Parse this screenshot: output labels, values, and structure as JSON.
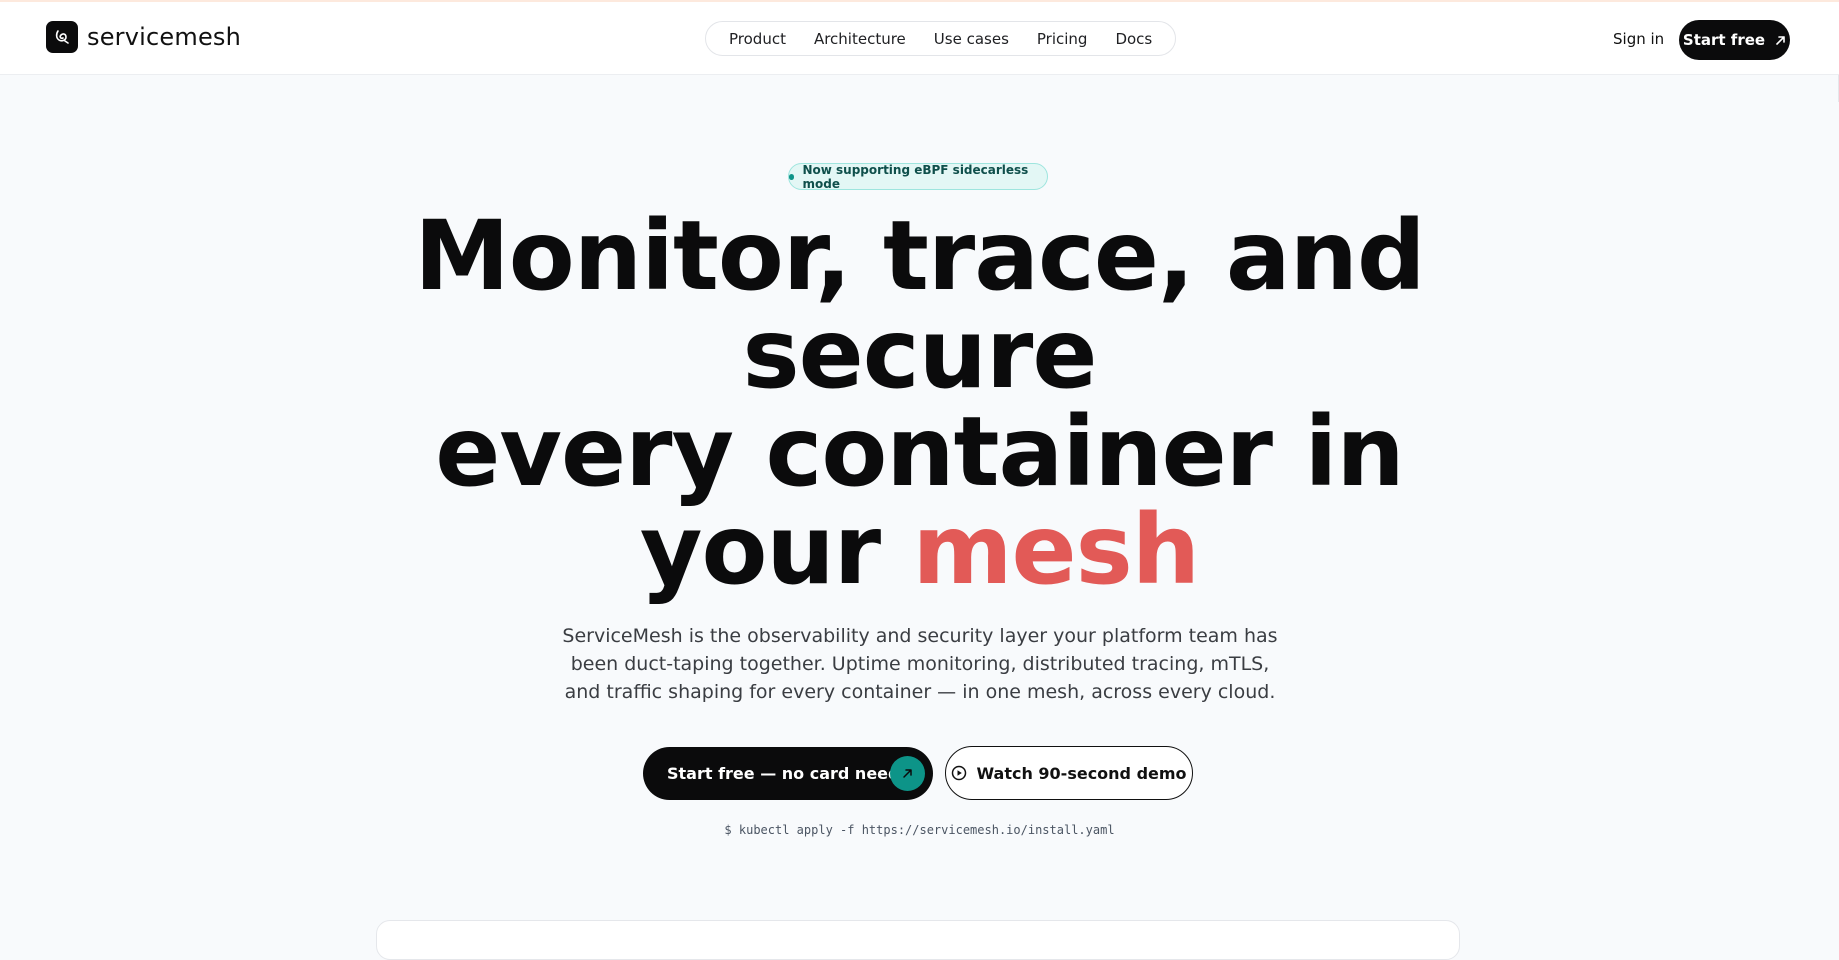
{
  "brand": {
    "name": "servicemesh",
    "logo_icon": "loop-mark-icon"
  },
  "nav": {
    "links": [
      "Product",
      "Architecture",
      "Use cases",
      "Pricing",
      "Docs"
    ],
    "sign_in": "Sign in",
    "start_free": "Start free",
    "start_free_icon": "arrow-up-right-icon"
  },
  "hero": {
    "badge": "Now supporting eBPF sidecarless mode",
    "headline_lines": [
      "Monitor, trace, and",
      "secure",
      "every container in"
    ],
    "headline_last_prefix": "your ",
    "headline_accent": "mesh",
    "subtitle": "ServiceMesh is the observability and security layer your platform team has been duct-taping together. Uptime monitoring, distributed tracing, mTLS, and traffic shaping for every container — in one mesh, across every cloud.",
    "cta_primary": "Start free — no card needed",
    "cta_secondary": "Watch 90-second demo",
    "install_command": "$ kubectl apply -f https://servicemesh.io/install.yaml"
  },
  "colors": {
    "accent_red": "#e25a57",
    "teal": "#0d9488",
    "badge_bg": "#e3f7f5",
    "dark": "#0b0b0c",
    "page_bg": "#f8fafc"
  }
}
